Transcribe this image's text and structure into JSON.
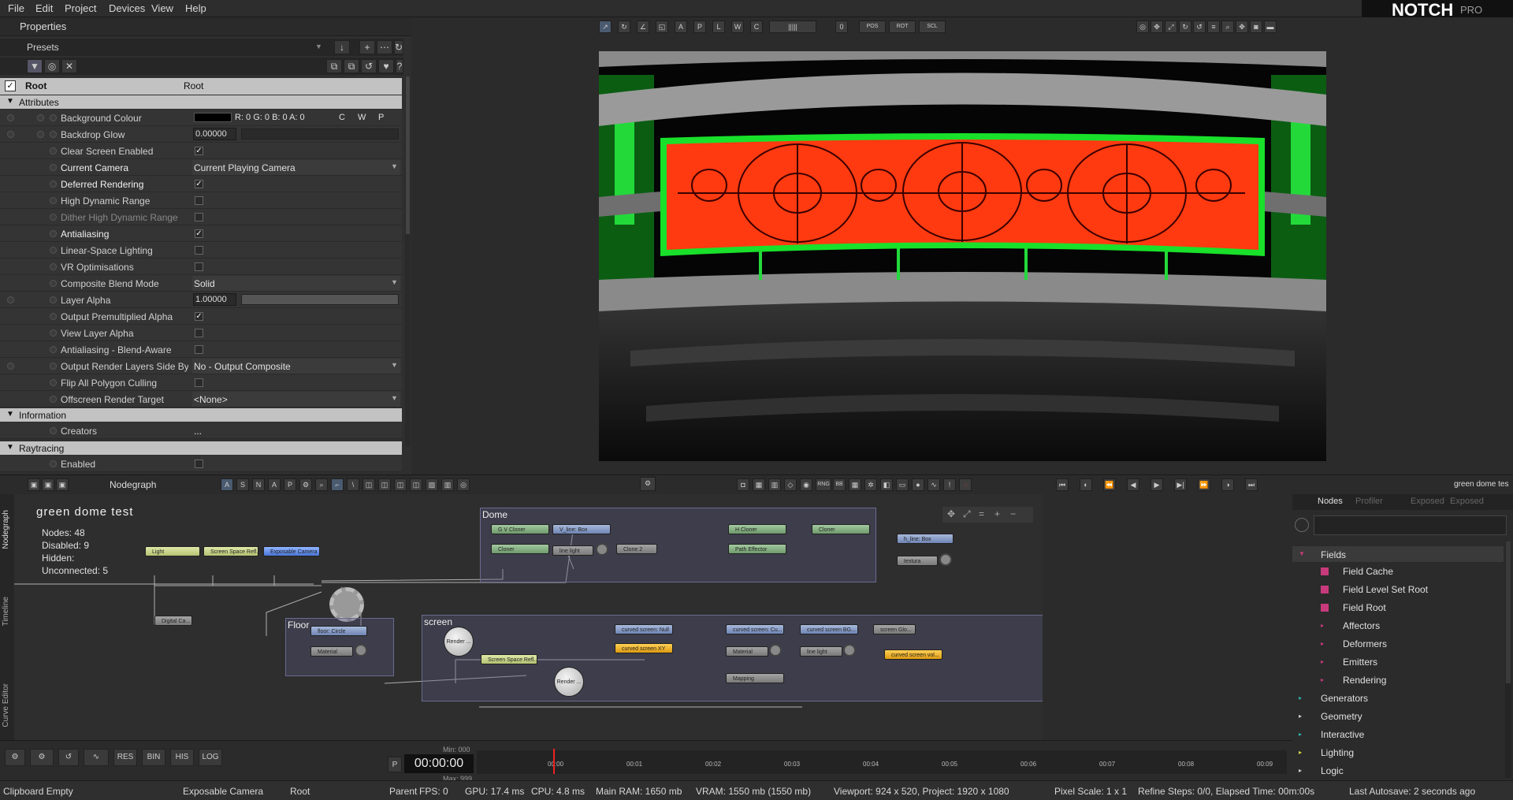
{
  "menu": [
    "File",
    "Edit",
    "Project",
    "Devices",
    "View",
    "Help"
  ],
  "logo": {
    "word": "NOTCH",
    "edition": "PRO"
  },
  "properties": {
    "title": "Properties",
    "presets_label": "Presets",
    "root_name": "Root",
    "root_value": "Root",
    "sections": {
      "attributes": "Attributes",
      "information": "Information",
      "raytracing": "Raytracing"
    },
    "rows": [
      {
        "name": "Background Colour",
        "value": "R: 0 G: 0 B: 0 A: 0",
        "suffix": [
          "C",
          "W",
          "P"
        ]
      },
      {
        "name": "Backdrop Glow",
        "value": "0.00000"
      },
      {
        "name": "Clear Screen Enabled",
        "checked": "✓"
      },
      {
        "name": "Current Camera",
        "value": "Current Playing Camera"
      },
      {
        "name": "Deferred Rendering",
        "checked": "✓"
      },
      {
        "name": "High Dynamic Range",
        "checked": ""
      },
      {
        "name": "Dither High Dynamic Range",
        "checked": ""
      },
      {
        "name": "Antialiasing",
        "checked": "✓"
      },
      {
        "name": "Linear-Space Lighting",
        "checked": ""
      },
      {
        "name": "VR Optimisations",
        "checked": ""
      },
      {
        "name": "Composite Blend Mode",
        "value": "Solid"
      },
      {
        "name": "Layer Alpha",
        "value": "1.00000",
        "level": 1.0
      },
      {
        "name": "Output Premultiplied Alpha",
        "checked": "✓"
      },
      {
        "name": "View Layer Alpha",
        "checked": ""
      },
      {
        "name": "Antialiasing - Blend-Aware",
        "checked": ""
      },
      {
        "name": "Output Render Layers Side By S",
        "value": "No - Output Composite"
      },
      {
        "name": "Flip All Polygon Culling",
        "checked": ""
      },
      {
        "name": "Offscreen Render Target",
        "value": "<None>"
      }
    ],
    "info_rows": [
      {
        "name": "Creators",
        "value": "..."
      }
    ],
    "ray_rows": [
      {
        "name": "Enabled",
        "checked": ""
      }
    ]
  },
  "viewport_toolbar": {
    "frame_number": "0",
    "labels": [
      "POS",
      "ROT",
      "SCL"
    ]
  },
  "nodegraph": {
    "panel_title": "Nodegraph",
    "scene_name": "green dome test",
    "right_label": "green dome tes",
    "stats": [
      {
        "label": "Nodes:",
        "value": "48"
      },
      {
        "label": "Disabled:",
        "value": "9"
      },
      {
        "label": "Hidden:",
        "value": ""
      },
      {
        "label": "Unconnected:",
        "value": "5"
      }
    ],
    "side_tabs": [
      "Nodegraph",
      "Timeline",
      "Curve Editor"
    ],
    "groups": {
      "dome": "Dome",
      "floor": "Floor",
      "screen": "screen"
    },
    "nodes": {
      "light": "Light",
      "ssr": "Screen Space Refl...",
      "camera": "Exposable Camera",
      "digital": "Digital Ca...",
      "gv_cloner": "G V Cloner",
      "v_line_box": "V_line: Box",
      "cloner1": "Cloner",
      "line_light": "line light",
      "clone2": "Clone 2",
      "h_cloner": "H Cloner",
      "cloner2": "Cloner",
      "h_line_box": "h_line: Box",
      "path_effector": "Path Effector",
      "textura": "textura",
      "floor_circle": "floor: Circle",
      "material_floor": "Material",
      "render1": "Render ...",
      "ssr2": "Screen Space Refl...",
      "render2": "Render ...",
      "curved_null": "curved screen: Null",
      "curved_xy": "curved screen XY",
      "curved_cu": "curved screen: Cu...",
      "curved_bg": "curved screen BG...",
      "screen_glo": "screen Glo...",
      "material_screen": "Material",
      "line_light2": "line light",
      "curved_vol": "curved screen vol...",
      "mapping": "Mapping"
    }
  },
  "nodes_panel": {
    "tabs": [
      "Nodes",
      "Profiler",
      "Exposed",
      "Exposed"
    ],
    "tree": [
      {
        "label": "Fields",
        "level": 0,
        "arrow": "▼",
        "arrow_color": "#c83a7c"
      },
      {
        "label": "Field Cache",
        "level": 2,
        "leaf": true
      },
      {
        "label": "Field Level Set Root",
        "level": 2,
        "leaf": true
      },
      {
        "label": "Field Root",
        "level": 2,
        "leaf": true
      },
      {
        "label": "Affectors",
        "level": 1,
        "arrow": "▸",
        "arrow_color": "#c83a7c"
      },
      {
        "label": "Deformers",
        "level": 1,
        "arrow": "▸",
        "arrow_color": "#c83a7c"
      },
      {
        "label": "Emitters",
        "level": 1,
        "arrow": "▸",
        "arrow_color": "#c83a7c"
      },
      {
        "label": "Rendering",
        "level": 1,
        "arrow": "▸",
        "arrow_color": "#c83a7c"
      },
      {
        "label": "Generators",
        "level": 0,
        "arrow": "▸",
        "arrow_color": "#2fb0a8"
      },
      {
        "label": "Geometry",
        "level": 0,
        "arrow": "▸",
        "arrow_color": "#d0d0d0"
      },
      {
        "label": "Interactive",
        "level": 0,
        "arrow": "▸",
        "arrow_color": "#2fb0a8"
      },
      {
        "label": "Lighting",
        "level": 0,
        "arrow": "▸",
        "arrow_color": "#d8d84a"
      },
      {
        "label": "Logic",
        "level": 0,
        "arrow": "▸",
        "arrow_color": "#d0d0d0"
      }
    ]
  },
  "timeline": {
    "buttons": [
      "RES",
      "BIN",
      "HIS",
      "LOG"
    ],
    "p_label": "P",
    "timecode": "00:00:00",
    "min": "Min: 000",
    "max": "Max: 999",
    "ticks": [
      "00:00",
      "00:01",
      "00:02",
      "00:03",
      "00:04",
      "00:05",
      "00:06",
      "00:07",
      "00:08",
      "00:09"
    ]
  },
  "status": {
    "clipboard": "Clipboard Empty",
    "camera": "Exposable Camera",
    "root": "Root",
    "parent": "Parent",
    "fps": "FPS: 0",
    "gpu": "GPU: 17.4 ms",
    "cpu": "CPU: 4.8 ms",
    "ram": "Main RAM: 1650 mb",
    "vram": "VRAM: 1550 mb (1550 mb)",
    "viewport": "Viewport: 924 x 520, Project: 1920 x 1080",
    "pixel_scale": "Pixel Scale: 1 x 1",
    "refine": "Refine Steps: 0/0, Elapsed Time: 00m:00s",
    "autosave": "Last Autosave: 2 seconds ago"
  },
  "colors": {
    "accent_green": "#19e02a",
    "screen_red": "#ff3a10",
    "pink": "#c83a7c"
  }
}
